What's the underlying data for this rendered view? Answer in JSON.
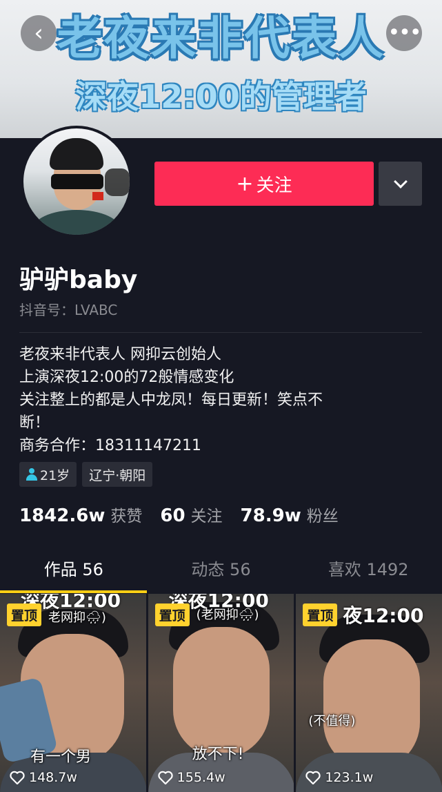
{
  "banner": {
    "line1": "老夜来非代表人",
    "line2": "深夜12:00的管理者"
  },
  "nav": {
    "back_icon": "chevron-left-icon",
    "more_icon": "more-dots-icon",
    "back_glyph": "‹",
    "more_glyph": "•••"
  },
  "profile": {
    "follow_label": "关注",
    "follow_plus": "+",
    "name": "驴驴baby",
    "douyin_id": "抖音号：LVABC",
    "bio": [
      "老夜来非代表人  网抑云创始人",
      "上演深夜12:00的72般情感变化",
      "关注整上的都是人中龙凤！每日更新！笑点不",
      "断！",
      "商务合作：18311147211"
    ],
    "tags": {
      "age": "21岁",
      "location": "辽宁·朝阳"
    },
    "stats": [
      {
        "num": "1842.6w",
        "label": "获赞"
      },
      {
        "num": "60",
        "label": "关注"
      },
      {
        "num": "78.9w",
        "label": "粉丝"
      }
    ]
  },
  "tabs": [
    {
      "label": "作品 56",
      "active": true
    },
    {
      "label": "动态 56",
      "active": false
    },
    {
      "label": "喜欢 1492",
      "active": false
    }
  ],
  "videos": [
    {
      "pin": "置顶",
      "top_caption": "深夜12:00",
      "caption": "老网抑🌧)",
      "mid_caption": "有一个男",
      "likes": "148.7w"
    },
    {
      "pin": "置顶",
      "top_caption": "深夜12:00",
      "caption": "(老网抑🌧)",
      "mid_caption": "放不下!",
      "likes": "155.4w"
    },
    {
      "pin": "置顶",
      "top_caption": "夜12:00",
      "caption": "(不值得)",
      "mid_caption": "",
      "likes": "123.1w"
    }
  ],
  "colors": {
    "background": "#161823",
    "follow_button": "#fd2c55",
    "tab_indicator": "#face15",
    "pin_badge": "#ffd22e"
  }
}
